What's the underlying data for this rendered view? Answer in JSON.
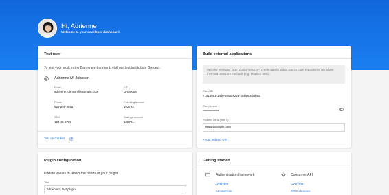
{
  "header": {
    "greeting": "Hi, Adrienne",
    "subtitle": "Welcome to your developer dashboard",
    "banner_color": "#1a73e8"
  },
  "test_user": {
    "title": "Test user",
    "intro": "To test your work in the Banno environment, visit our test institution, Garden.",
    "name": "Adrienne M. Johnson",
    "fields": [
      {
        "label": "Email",
        "value": "adrienne.johnson@example.com"
      },
      {
        "label": "CIF",
        "value": "DAA0058"
      },
      {
        "label": "Phone",
        "value": "555-555-5555"
      },
      {
        "label": "Checking account",
        "value": "102734"
      },
      {
        "label": "SSN",
        "value": "123-45-6789"
      },
      {
        "label": "Savings account",
        "value": "108741"
      }
    ],
    "link": "Test on Garden"
  },
  "build": {
    "title": "Build external applications",
    "notice": "Security reminder: Don't publish your API credentials in public source code repositories nor share them via unsecure methods (e.g. email or SMS).",
    "client_id_label": "Client ID",
    "client_id": "71414681-14de-4065-822a-28b58ceb9b9a",
    "secret_label": "Client secret",
    "secret": "••••••••••••••••••••••••••••",
    "redirect_label": "Redirect URIs (max 5)",
    "redirect_value": "www.example.com",
    "add_redirect": "+ Add redirect URI"
  },
  "plugin": {
    "title": "Plugin configuration",
    "intro": "Update values to reflect the needs of your plugin",
    "title_label": "Title",
    "title_value": "Adrienne's test plugin"
  },
  "getting_started": {
    "title": "Getting started",
    "col1_title": "Authentication framework",
    "col1_links": [
      "Overview",
      "Architecture"
    ],
    "col2_title": "Consumer API",
    "col2_links": [
      "Overview",
      "API Reference"
    ]
  }
}
